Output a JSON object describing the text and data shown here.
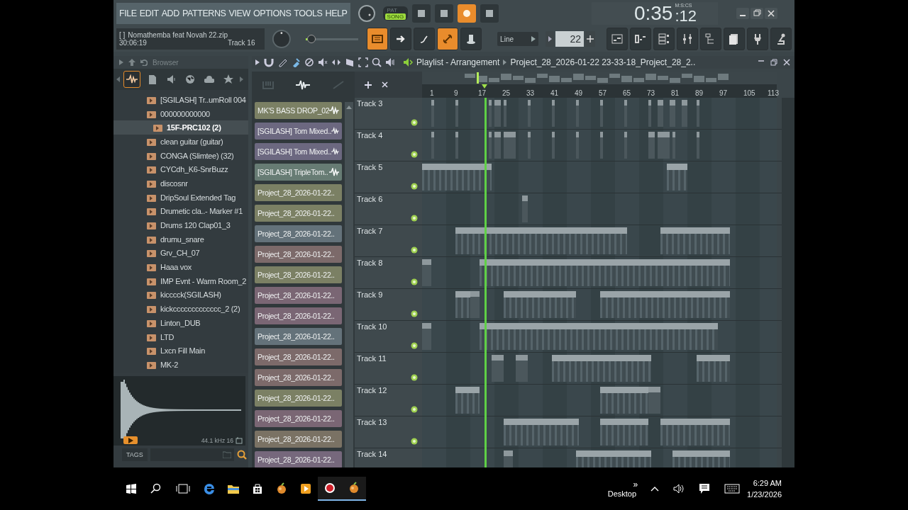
{
  "menu": [
    "FILE",
    "EDIT",
    "ADD",
    "PATTERNS",
    "VIEW",
    "OPTIONS",
    "TOOLS",
    "HELP"
  ],
  "mode_switch": [
    {
      "label": "PAT",
      "selected": false
    },
    {
      "label": "SONG",
      "selected": true
    }
  ],
  "time_display": {
    "main": "0:35",
    "small": ":12",
    "unit": "M:S:CS"
  },
  "hint_panel": {
    "bracket": "[   ]",
    "text": "Nomathemba feat Novah  22.zip",
    "time": "30:06:19",
    "track": "Track 16"
  },
  "pitch_slider": {
    "level": 0.1
  },
  "snap": {
    "label": "Line"
  },
  "pattern_number": "22",
  "browser": {
    "title": "Browser",
    "tabs": [
      {
        "selected": true
      },
      {
        "selected": false
      },
      {
        "selected": false
      },
      {
        "selected": false
      },
      {
        "selected": false
      },
      {
        "selected": false
      }
    ],
    "items": [
      {
        "label": "[SGILASH] Tr..umRoll 004",
        "selected": false
      },
      {
        "label": "000000000000",
        "selected": false,
        "children": [
          {
            "label": "15F-PRC102 (2)",
            "selected": true
          }
        ]
      },
      {
        "label": "clean guitar (guitar)",
        "selected": false
      },
      {
        "label": "CONGA (Slimtee) (32)",
        "selected": false
      },
      {
        "label": "CYCdh_K6-SnrBuzz",
        "selected": false
      },
      {
        "label": "discosnr",
        "selected": false
      },
      {
        "label": "DripSoul Extended Tag",
        "selected": false
      },
      {
        "label": "Drumetic cla..- Marker #1",
        "selected": false
      },
      {
        "label": "Drums 120 Clap01_3",
        "selected": false
      },
      {
        "label": "drumu_snare",
        "selected": false
      },
      {
        "label": "Grv_CH_07",
        "selected": false
      },
      {
        "label": "Haaa vox",
        "selected": false
      },
      {
        "label": "IMP Evnt - Warm Room_2",
        "selected": false
      },
      {
        "label": "kicccck(SGILASH)",
        "selected": false
      },
      {
        "label": "kickccccccccccccc_2 (2)",
        "selected": false
      },
      {
        "label": "Linton_DUB",
        "selected": false
      },
      {
        "label": "LTD",
        "selected": false
      },
      {
        "label": "Lxcn Fill Main",
        "selected": false
      },
      {
        "label": "MK-2",
        "selected": false
      }
    ],
    "preview": {
      "info": "44.1 kHz 16"
    },
    "tags_label": "TAGS"
  },
  "picker": {
    "items": [
      {
        "label": "MK'S BASS DROP_02",
        "color": "#7b8064",
        "kind": "audio"
      },
      {
        "label": "[SGILASH] Tom Mixed..",
        "color": "#6c6880",
        "kind": "audio"
      },
      {
        "label": "[SGILASH] Tom Mixed..",
        "color": "#6c6880",
        "kind": "audio"
      },
      {
        "label": "[SGILASH] TripleTom..",
        "color": "#677c74",
        "kind": "audio"
      },
      {
        "label": "Project_28_2026-01-22..",
        "color": "#7b8064",
        "kind": "pattern"
      },
      {
        "label": "Project_28_2026-01-22..",
        "color": "#7b8064",
        "kind": "pattern"
      },
      {
        "label": "Project_28_2026-01-22..",
        "color": "#64727a",
        "kind": "pattern"
      },
      {
        "label": "Project_28_2026-01-22..",
        "color": "#7c6a6a",
        "kind": "pattern"
      },
      {
        "label": "Project_28_2026-01-22..",
        "color": "#7b8064",
        "kind": "pattern"
      },
      {
        "label": "Project_28_2026-01-22..",
        "color": "#7a6674",
        "kind": "pattern"
      },
      {
        "label": "Project_28_2026-01-22..",
        "color": "#7a6674",
        "kind": "pattern"
      },
      {
        "label": "Project_28_2026-01-22..",
        "color": "#64727a",
        "kind": "pattern"
      },
      {
        "label": "Project_28_2026-01-22..",
        "color": "#7c6a6a",
        "kind": "pattern"
      },
      {
        "label": "Project_28_2026-01-22..",
        "color": "#7c6a6a",
        "kind": "pattern"
      },
      {
        "label": "Project_28_2026-01-22..",
        "color": "#7b8064",
        "kind": "pattern"
      },
      {
        "label": "Project_28_2026-01-22..",
        "color": "#7a6674",
        "kind": "pattern"
      },
      {
        "label": "Project_28_2026-01-22..",
        "color": "#7a7264",
        "kind": "pattern"
      },
      {
        "label": "Project_28_2026-01-22..",
        "color": "#76687c",
        "kind": "pattern"
      }
    ]
  },
  "playlist": {
    "title": "Playlist - Arrangement",
    "project": "Project_28_2026-01-22 23-33-18_Project_28_2..",
    "ruler": [
      "1",
      "9",
      "17",
      "25",
      "33",
      "41",
      "49",
      "57",
      "65",
      "73",
      "81",
      "89",
      "97",
      "105",
      "113"
    ],
    "song_position": {
      "level": 0.176
    },
    "tracks": [
      {
        "name": "Track 3"
      },
      {
        "name": "Track 4"
      },
      {
        "name": "Track 5"
      },
      {
        "name": "Track 6"
      },
      {
        "name": "Track 7"
      },
      {
        "name": "Track 8"
      },
      {
        "name": "Track 9"
      },
      {
        "name": "Track 10"
      },
      {
        "name": "Track 11"
      },
      {
        "name": "Track 12"
      },
      {
        "name": "Track 13"
      },
      {
        "name": "Track 14"
      }
    ]
  },
  "taskbar": {
    "apps": [
      {
        "kind": "browser",
        "running": false
      },
      {
        "kind": "folder",
        "running": false
      },
      {
        "kind": "store",
        "running": false
      },
      {
        "kind": "fruit",
        "running": false
      },
      {
        "kind": "player",
        "running": false
      },
      {
        "kind": "record",
        "running": true
      },
      {
        "kind": "fruit",
        "running": true
      }
    ],
    "overflow": "»",
    "desktop": "Desktop",
    "time": "6:29 AM",
    "date": "1/23/2026"
  }
}
